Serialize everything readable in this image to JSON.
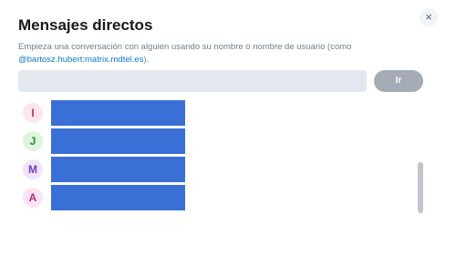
{
  "dialog": {
    "title": "Mensajes directos",
    "close_icon": "×",
    "description_prefix": "Empieza una conversación con alguien usando su nombre o nombre de usuario (como ",
    "description_user_id": "@bartosz.hubert:matrix.mdtel.es",
    "description_suffix": ").",
    "search_value": "",
    "go_button_label": "Ir"
  },
  "dm_list": [
    {
      "initial": "I",
      "avatar_bg": "#fde6ec",
      "avatar_fg": "#c0325a"
    },
    {
      "initial": "J",
      "avatar_bg": "#dff4df",
      "avatar_fg": "#2e8b3a"
    },
    {
      "initial": "M",
      "avatar_bg": "#efe4fb",
      "avatar_fg": "#7a3cc9"
    },
    {
      "initial": "A",
      "avatar_bg": "#fbe4f2",
      "avatar_fg": "#b02d7a"
    }
  ],
  "colors": {
    "name_redaction": "#3a6fd6",
    "link": "#0b7ad1"
  }
}
